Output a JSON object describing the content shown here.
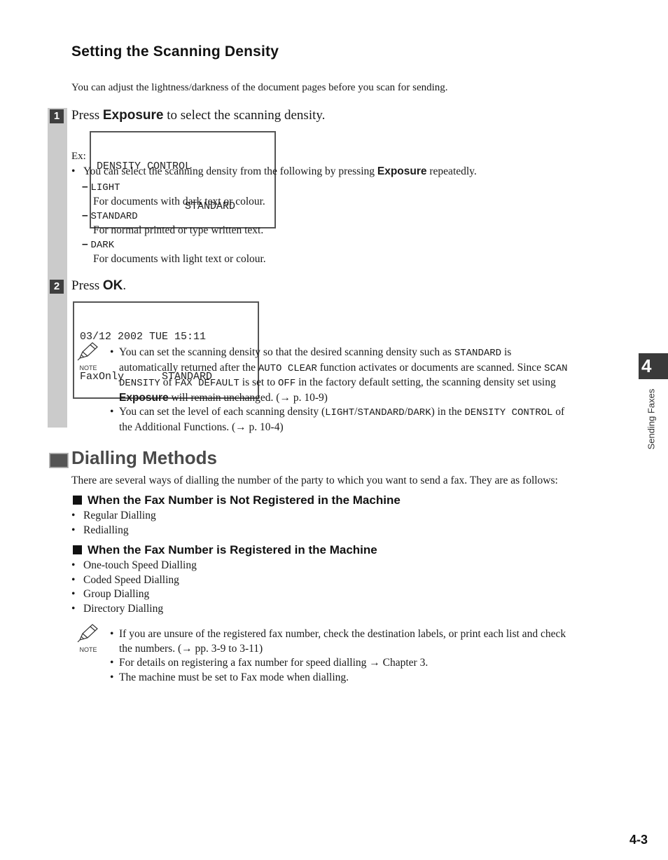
{
  "section1": {
    "title": "Setting the Scanning Density",
    "intro": "You can adjust the lightness/darkness of the document pages before you scan for sending."
  },
  "step1": {
    "number": "1",
    "text_pre": "Press ",
    "key": "Exposure",
    "text_post": " to select the scanning density.",
    "ex_label": "Ex:",
    "lcd_line1": "DENSITY CONTROL",
    "lcd_line2": "              STANDARD",
    "bullet_pre": "You can select the scanning density from the following by pressing ",
    "bullet_key": "Exposure",
    "bullet_post": " repeatedly.",
    "options": [
      {
        "dash": "–",
        "name": "LIGHT",
        "desc": "For documents with dark text or colour."
      },
      {
        "dash": "–",
        "name": "STANDARD",
        "desc": "For normal printed or type written text."
      },
      {
        "dash": "–",
        "name": "DARK",
        "desc": "For documents with light text or colour."
      }
    ]
  },
  "step2": {
    "number": "2",
    "text_pre": "Press ",
    "key": "OK",
    "text_post": ".",
    "lcd_line1": "03/12 2002 TUE 15:11",
    "lcd_line2": "FaxOnly      STANDARD"
  },
  "note1": {
    "label": "NOTE",
    "b1": {
      "l1a": "You can set the scanning density so that the desired scanning density such as ",
      "l1m": "STANDARD",
      "l1b": " is",
      "l2a": "automatically returned after the ",
      "l2m": "AUTO CLEAR",
      "l2b": " function activates or documents are scanned. Since ",
      "l2m2": "SCAN",
      "l3m": "DENSITY",
      "l3a": " of ",
      "l3m2": "FAX DEFAULT",
      "l3b": " is set to ",
      "l3m3": "OFF",
      "l3c": " in the factory default setting, the scanning density set using",
      "l4k": "Exposure",
      "l4a": " will remain unchanged. (→ p. 10-9)"
    },
    "b2": {
      "l1a": "You can set the level of each scanning density (",
      "l1m": "LIGHT",
      "l1s1": "/",
      "l1m2": "STANDARD",
      "l1s2": "/",
      "l1m3": "DARK",
      "l1b": ") in the ",
      "l1m4": "DENSITY CONTROL",
      "l1c": " of",
      "l2": "the Additional Functions. (→ p. 10-4)"
    }
  },
  "section2": {
    "title": "Dialling Methods",
    "intro": "There are several ways of dialling the number of the party to which you want to send a fax. They are as follows:",
    "sub1": {
      "title": "When the Fax Number is Not Registered in the Machine",
      "items": [
        "Regular Dialling",
        "Redialling"
      ]
    },
    "sub2": {
      "title": "When the Fax Number is Registered in the Machine",
      "items": [
        "One-touch Speed Dialling",
        "Coded Speed Dialling",
        "Group Dialling",
        "Directory Dialling"
      ]
    },
    "note": {
      "label": "NOTE",
      "b1_l1": "If you are unsure of the registered fax number, check the destination labels, or print each list and check",
      "b1_l2": "the numbers. (→ pp. 3-9 to 3-11)",
      "b2": "For details on registering a fax number for speed dialling → Chapter 3.",
      "b3": "The machine must be set to Fax mode when dialling."
    }
  },
  "side_tab": {
    "chapter": "4",
    "label": "Sending Faxes"
  },
  "page_number": "4-3",
  "bullet_char": "•"
}
